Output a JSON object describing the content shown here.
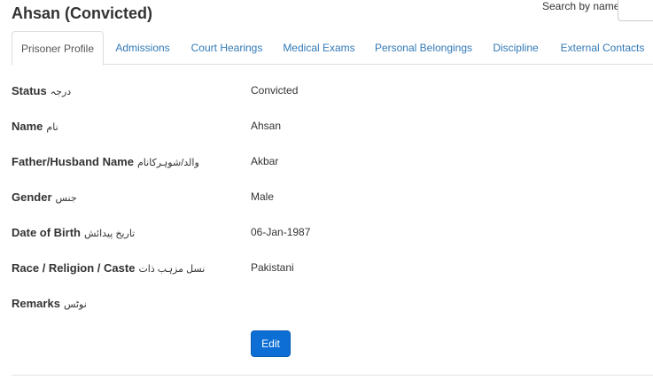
{
  "header": {
    "title": "Ahsan (Convicted)",
    "search_label": "Search by name",
    "search_value": ""
  },
  "tabs": [
    {
      "label": "Prisoner Profile",
      "active": true
    },
    {
      "label": "Admissions",
      "active": false
    },
    {
      "label": "Court Hearings",
      "active": false
    },
    {
      "label": "Medical Exams",
      "active": false
    },
    {
      "label": "Personal Belongings",
      "active": false
    },
    {
      "label": "Discipline",
      "active": false
    },
    {
      "label": "External Contacts",
      "active": false
    }
  ],
  "profile": {
    "fields": [
      {
        "label": "Status",
        "urdu": "درجہ",
        "value": "Convicted"
      },
      {
        "label": "Name",
        "urdu": "نام",
        "value": "Ahsan"
      },
      {
        "label": "Father/Husband Name",
        "urdu": "والد/شوہرکانام",
        "value": "Akbar"
      },
      {
        "label": "Gender",
        "urdu": "جنس",
        "value": "Male"
      },
      {
        "label": "Date of Birth",
        "urdu": "تاریخ پیدائش",
        "value": "06-Jan-1987"
      },
      {
        "label": "Race / Religion / Caste",
        "urdu": "نسل مزہب ذات",
        "value": "Pakistani"
      },
      {
        "label": "Remarks",
        "urdu": "نوٹس",
        "value": ""
      }
    ],
    "edit_label": "Edit"
  },
  "colors": {
    "link": "#337ab7",
    "primary_button": "#0d6fd6",
    "border": "#dddddd"
  }
}
